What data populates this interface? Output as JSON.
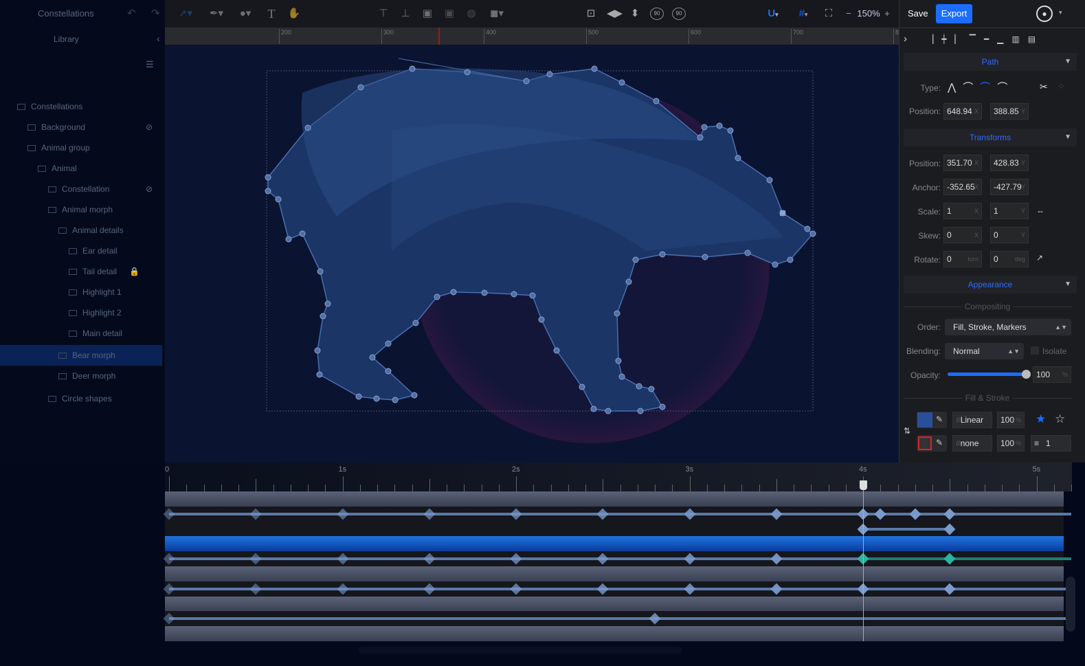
{
  "app": {
    "title": "Constellations"
  },
  "sidebar": {
    "library_label": "Library",
    "layers": [
      {
        "label": "Constellations",
        "indent": 1,
        "hidden": false
      },
      {
        "label": "Background",
        "indent": 2,
        "hidden": true
      },
      {
        "label": "Animal group",
        "indent": 2,
        "hidden": false
      },
      {
        "label": "Animal",
        "indent": 3,
        "hidden": false
      },
      {
        "label": "Constellation",
        "indent": 4,
        "hidden": true
      },
      {
        "label": "Animal morph",
        "indent": 4,
        "hidden": false
      },
      {
        "label": "Animal details",
        "indent": 5,
        "hidden": false
      },
      {
        "label": "Ear detail",
        "indent": 6,
        "hidden": false
      },
      {
        "label": "Tail detail",
        "indent": 6,
        "hidden": false,
        "locked": true
      },
      {
        "label": "Highlight 1",
        "indent": 6,
        "hidden": false
      },
      {
        "label": "Highlight 2",
        "indent": 6,
        "hidden": false
      },
      {
        "label": "Main detail",
        "indent": 6,
        "hidden": false
      },
      {
        "label": "Bear morph",
        "indent": 5,
        "selected": true
      },
      {
        "label": "Deer morph",
        "indent": 5
      },
      {
        "label": "Circle shapes",
        "indent": 4
      }
    ]
  },
  "toolbar": {
    "icons": [
      "undo-icon",
      "redo-icon",
      "select-tool-icon",
      "pen-tool-icon",
      "shape-tool-icon",
      "text-tool-icon",
      "hand-tool-icon",
      "align-top-icon",
      "align-bottom-icon",
      "group-icon",
      "ungroup-icon",
      "mask-icon",
      "boolean-icon",
      "fit-icon",
      "flip-horizontal-icon",
      "flip-vertical-icon",
      "rotate-ccw-90-icon",
      "rotate-cw-90-icon",
      "magnet-icon",
      "grid-icon",
      "fullscreen-icon"
    ],
    "text_tool": "T",
    "zoom": "150%",
    "zoom_minus": "−",
    "zoom_plus": "+",
    "rotate_label": "90",
    "save_label": "Save",
    "export_label": "Export"
  },
  "ruler": {
    "labels": [
      "200",
      "300",
      "400",
      "500",
      "600",
      "700",
      "8"
    ]
  },
  "panel": {
    "path": {
      "title": "Path",
      "type_label": "Type:",
      "position_label": "Position:",
      "position_x": "648.94",
      "position_y": "388.85"
    },
    "transforms": {
      "title": "Transforms",
      "position_label": "Position:",
      "position_x": "351.70",
      "position_y": "428.83",
      "anchor_label": "Anchor:",
      "anchor_x": "-352.65",
      "anchor_y": "-427.79",
      "scale_label": "Scale:",
      "scale_x": "1",
      "scale_y": "1",
      "skew_label": "Skew:",
      "skew_x": "0",
      "skew_y": "0",
      "rotate_label": "Rotate:",
      "rotate_turn": "0",
      "rotate_deg": "0",
      "unit_x": "X",
      "unit_y": "Y",
      "unit_turn": "turn",
      "unit_deg": "deg"
    },
    "appearance": {
      "title": "Appearance",
      "compositing_label": "Compositing",
      "order_label": "Order:",
      "order_value": "Fill, Stroke, Markers",
      "blending_label": "Blending:",
      "blending_value": "Normal",
      "isolate_label": "Isolate",
      "isolate_checked": false,
      "opacity_label": "Opacity:",
      "opacity_value": "100",
      "opacity_percent": 100,
      "pct": "%"
    },
    "fill_stroke": {
      "title": "Fill & Stroke",
      "fill_type": "Linear",
      "fill_opacity": "100",
      "stroke_type": "none",
      "stroke_opacity": "100",
      "stroke_width": "1",
      "hash": "#",
      "fill_color": "#2a4f9a"
    }
  },
  "timeline": {
    "labels": [
      "0",
      "1s",
      "2s",
      "3s",
      "4s",
      "5s"
    ],
    "playhead_s": 4.0,
    "rows": [
      {
        "style": "band",
        "keys": []
      },
      {
        "style": "dark",
        "keys": [
          0,
          0.5,
          1,
          1.5,
          2,
          2.5,
          3,
          3.5,
          4,
          4.1,
          4.3,
          4.5
        ]
      },
      {
        "style": "dark",
        "keys": [
          4,
          4.5
        ],
        "span": [
          4,
          4.5
        ]
      },
      {
        "style": "blue",
        "keys": []
      },
      {
        "style": "dark",
        "keys": [
          0,
          0.5,
          1,
          1.5,
          2,
          2.5,
          3,
          3.5,
          4,
          4.5
        ],
        "active": [
          4,
          4.5
        ]
      },
      {
        "style": "band",
        "keys": []
      },
      {
        "style": "dark",
        "keys": [
          0,
          0.5,
          1,
          1.5,
          2,
          2.5,
          3,
          3.5,
          4,
          4.5
        ]
      },
      {
        "style": "band",
        "keys": []
      },
      {
        "style": "dark",
        "keys": [
          0,
          2.8
        ]
      },
      {
        "style": "band",
        "keys": []
      }
    ]
  },
  "colors": {
    "accent": "#1a6dff",
    "keyframe": "#7a9acc",
    "keyframe_active": "#2bb3a0",
    "selection": "#0b3c9c"
  }
}
